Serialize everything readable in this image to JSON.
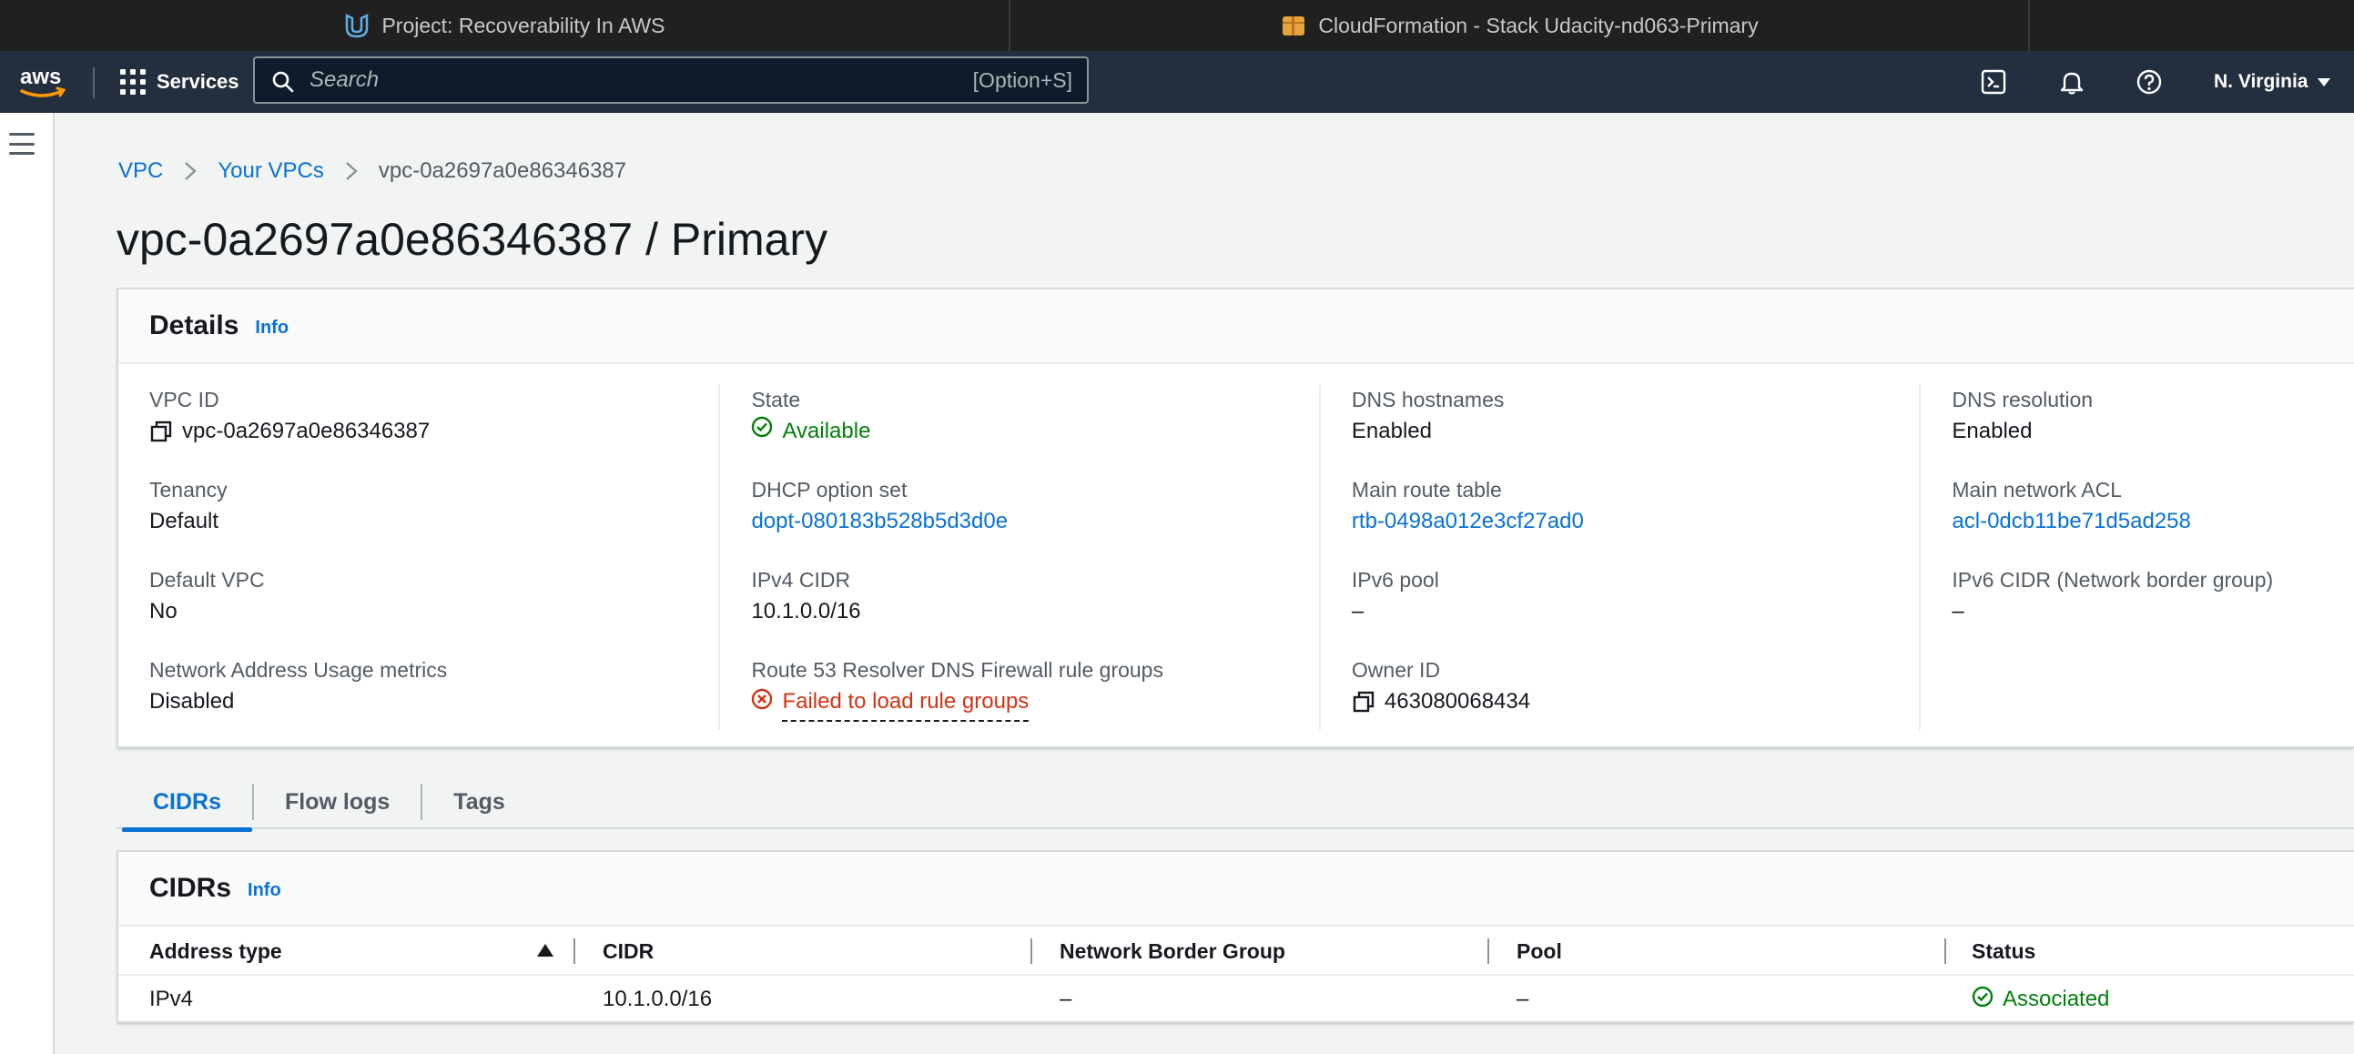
{
  "browser_tabs": [
    {
      "title": "Project: Recoverability In AWS",
      "icon": "udacity-icon"
    },
    {
      "title": "CloudFormation - Stack Udacity-nd063-Primary",
      "icon": "cloudformation-icon"
    }
  ],
  "topnav": {
    "logo": "aws",
    "services_label": "Services",
    "search_placeholder": "Search",
    "search_shortcut": "[Option+S]",
    "region": "N. Virginia"
  },
  "breadcrumb": {
    "items": [
      "VPC",
      "Your VPCs",
      "vpc-0a2697a0e86346387"
    ]
  },
  "page_title": "vpc-0a2697a0e86346387 / Primary",
  "details": {
    "title": "Details",
    "info": "Info",
    "columns": [
      [
        {
          "label": "VPC ID",
          "value": "vpc-0a2697a0e86346387"
        },
        {
          "label": "Tenancy",
          "value": "Default"
        },
        {
          "label": "Default VPC",
          "value": "No"
        },
        {
          "label": "Network Address Usage metrics",
          "value": "Disabled"
        }
      ],
      [
        {
          "label": "State",
          "value": "Available"
        },
        {
          "label": "DHCP option set",
          "value": "dopt-080183b528b5d3d0e"
        },
        {
          "label": "IPv4 CIDR",
          "value": "10.1.0.0/16"
        },
        {
          "label": "Route 53 Resolver DNS Firewall rule groups",
          "value": "Failed to load rule groups"
        }
      ],
      [
        {
          "label": "DNS hostnames",
          "value": "Enabled"
        },
        {
          "label": "Main route table",
          "value": "rtb-0498a012e3cf27ad0"
        },
        {
          "label": "IPv6 pool",
          "value": "–"
        },
        {
          "label": "Owner ID",
          "value": "463080068434"
        }
      ],
      [
        {
          "label": "DNS resolution",
          "value": "Enabled"
        },
        {
          "label": "Main network ACL",
          "value": "acl-0dcb11be71d5ad258"
        },
        {
          "label": "IPv6 CIDR (Network border group)",
          "value": "–"
        }
      ]
    ]
  },
  "tabs": [
    "CIDRs",
    "Flow logs",
    "Tags"
  ],
  "cidrs": {
    "title": "CIDRs",
    "info": "Info",
    "headers": [
      "Address type",
      "CIDR",
      "Network Border Group",
      "Pool",
      "Status"
    ],
    "rows": [
      [
        "IPv4",
        "10.1.0.0/16",
        "–",
        "–",
        "Associated"
      ]
    ]
  },
  "colors": {
    "link": "#0972d3",
    "success": "#037f0c",
    "error": "#d13212",
    "nav_bg": "#232f3e"
  }
}
